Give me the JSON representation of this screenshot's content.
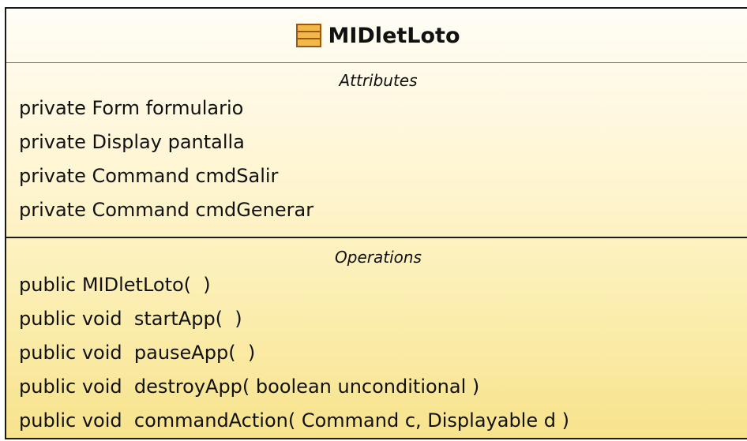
{
  "class": {
    "name": "MIDletLoto",
    "icon": "class-icon",
    "attributes_title": "Attributes",
    "attributes": [
      "private Form formulario",
      "private Display pantalla",
      "private Command cmdSalir",
      "private Command cmdGenerar"
    ],
    "operations_title": "Operations",
    "operations": [
      "public MIDletLoto(  )",
      "public void  startApp(  )",
      "public void  pauseApp(  )",
      "public void  destroyApp( boolean unconditional )",
      "public void  commandAction( Command c, Displayable d )"
    ]
  },
  "colors": {
    "border": "#1a1a1a",
    "fill_top": "#fffdf6",
    "fill_bottom": "#f7e38c",
    "icon_fill": "#f2b84a",
    "icon_stroke": "#9a5a12"
  }
}
